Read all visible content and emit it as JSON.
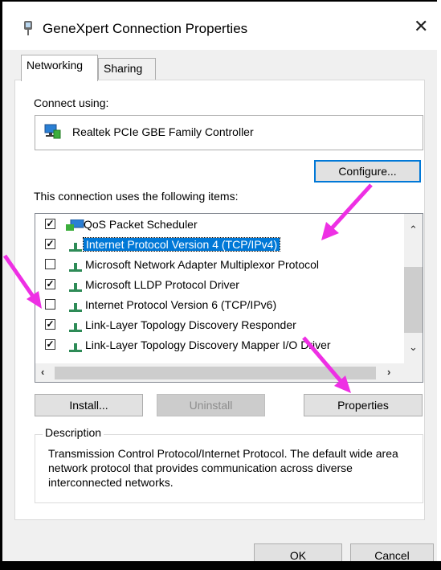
{
  "window": {
    "title": "GeneXpert Connection Properties"
  },
  "tabs": [
    {
      "label": "Networking"
    },
    {
      "label": "Sharing"
    }
  ],
  "connect_using": {
    "label": "Connect using:",
    "adapter": "Realtek PCIe GBE Family Controller",
    "configure_button": "Configure..."
  },
  "items": {
    "label": "This connection uses the following items:",
    "rows": [
      {
        "label": "QoS Packet Scheduler",
        "checked": true,
        "icon": "qos-icon"
      },
      {
        "label": "Internet Protocol Version 4 (TCP/IPv4)",
        "checked": true,
        "icon": "protocol-icon",
        "selected": true
      },
      {
        "label": "Microsoft Network Adapter Multiplexor Protocol",
        "checked": false,
        "icon": "protocol-icon"
      },
      {
        "label": "Microsoft LLDP Protocol Driver",
        "checked": true,
        "icon": "protocol-icon"
      },
      {
        "label": "Internet Protocol Version 6 (TCP/IPv6)",
        "checked": false,
        "icon": "protocol-icon"
      },
      {
        "label": "Link-Layer Topology Discovery Responder",
        "checked": true,
        "icon": "protocol-icon"
      },
      {
        "label": "Link-Layer Topology Discovery Mapper I/O Driver",
        "checked": true,
        "icon": "protocol-icon"
      }
    ]
  },
  "buttons": {
    "install": "Install...",
    "uninstall": "Uninstall",
    "properties": "Properties",
    "ok": "OK",
    "cancel": "Cancel"
  },
  "description": {
    "legend": "Description",
    "text": "Transmission Control Protocol/Internet Protocol. The default wide area network protocol that provides communication across diverse interconnected networks."
  },
  "annotation_color": "#ee2fe4",
  "selection_color": "#0078d7"
}
